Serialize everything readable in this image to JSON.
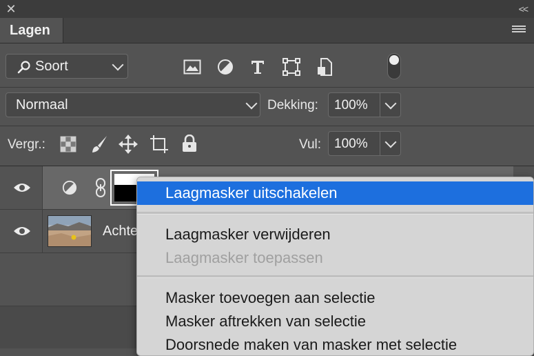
{
  "panel": {
    "close_glyph": "✕",
    "collapse_glyph": "<<",
    "tab_label": "Lagen"
  },
  "filter": {
    "kind_label": "Soort",
    "icons": [
      "image-filter-icon",
      "adjustment-filter-icon",
      "type-filter-icon",
      "shape-filter-icon",
      "smart-object-filter-icon"
    ]
  },
  "blend": {
    "mode": "Normaal",
    "opacity_label": "Dekking:",
    "opacity_value": "100%"
  },
  "lock": {
    "label": "Vergr.:",
    "fill_label": "Vul:",
    "fill_value": "100%"
  },
  "layers": [
    {
      "name": "",
      "type": "adjustment-with-mask",
      "visible": true
    },
    {
      "name": "Achte",
      "type": "photo",
      "visible": true
    }
  ],
  "context_menu": {
    "items": [
      {
        "label": "Laagmasker uitschakelen",
        "state": "active"
      },
      {
        "label": "Laagmasker verwijderen",
        "state": "normal"
      },
      {
        "label": "Laagmasker toepassen",
        "state": "disabled"
      },
      {
        "label": "Masker toevoegen aan selectie",
        "state": "normal"
      },
      {
        "label": "Masker aftrekken van selectie",
        "state": "normal"
      },
      {
        "label": "Doorsnede maken van masker met selectie",
        "state": "normal"
      }
    ]
  },
  "colors": {
    "panel_bg": "#535353",
    "highlight": "#1d6fde",
    "menu_bg": "#d5d5d5"
  }
}
